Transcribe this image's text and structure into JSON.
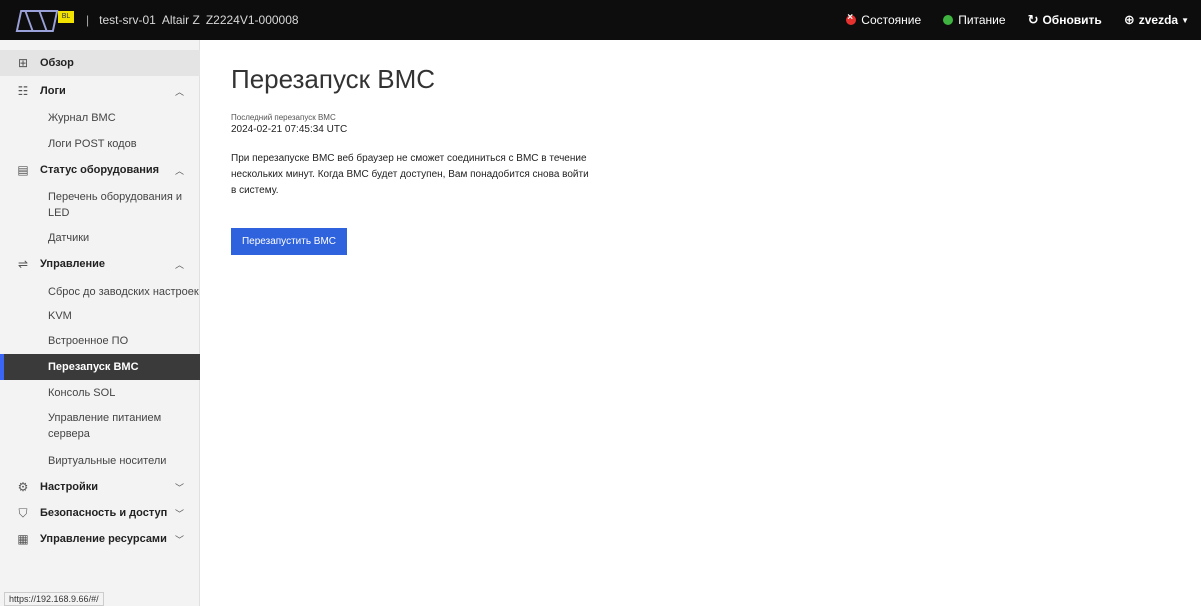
{
  "header": {
    "host": "test-srv-01",
    "model": "Altair Z",
    "serial": "Z2224V1-000008",
    "status_label": "Состояние",
    "power_label": "Питание",
    "refresh_label": "Обновить",
    "user_label": "zvezda",
    "logo_tag": "BL"
  },
  "sidebar": {
    "overview": "Обзор",
    "logs": {
      "label": "Логи",
      "items": [
        "Журнал BMC",
        "Логи POST кодов"
      ]
    },
    "hardware": {
      "label": "Статус оборудования",
      "items": [
        "Перечень оборудования и LED",
        "Датчики"
      ]
    },
    "control": {
      "label": "Управление",
      "items": [
        "Сброс до заводских настроек",
        "KVM",
        "Встроенное ПО",
        "Перезапуск BMC",
        "Консоль SOL",
        "Управление питанием сервера",
        "Виртуальные носители"
      ]
    },
    "settings": "Настройки",
    "security": "Безопасность и доступ",
    "resources": "Управление ресурсами"
  },
  "main": {
    "title": "Перезапуск BMC",
    "last_reboot_label": "Последний перезапуск BMC",
    "last_reboot_value": "2024-02-21 07:45:34 UTC",
    "description": "При перезапуске BMC веб браузер не сможет соединиться с BMC в течение нескольких минут. Когда BMC будет доступен, Вам понадобится снова войти в систему.",
    "reboot_button": "Перезапустить BMC"
  },
  "status_bar_url": "https://192.168.9.66/#/",
  "colors": {
    "header_bg": "#0d0d0d",
    "accent": "#2f62dd",
    "active_item_bg": "#3a3a3a",
    "status_error": "#e5322f",
    "status_ok": "#3fb33f"
  }
}
